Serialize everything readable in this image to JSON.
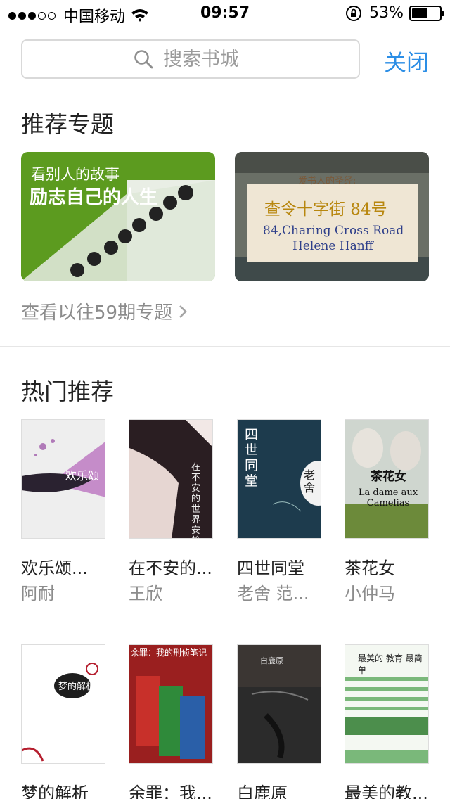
{
  "status_bar": {
    "carrier": "中国移动",
    "time": "09:57",
    "battery_percent": "53%",
    "signal_bars": 3,
    "battery_level": 0.53
  },
  "search": {
    "placeholder": "搜索书城",
    "close_label": "关闭"
  },
  "topics": {
    "title": "推荐专题",
    "cards": [
      {
        "line1": "看别人的故事",
        "line2": "励志自己的人生"
      },
      {
        "heading": "爱书人的圣经:",
        "cn_title": "查令十字街 84号",
        "en_title": "84,Charing Cross Road",
        "en_author": "Helene Hanff"
      }
    ],
    "history_label": "查看以往59期专题"
  },
  "hot": {
    "title": "热门推荐",
    "books": [
      {
        "title": "欢乐颂...",
        "author": "阿耐",
        "cover_text": "欢乐颂"
      },
      {
        "title": "在不安的...",
        "author": "王欣",
        "cover_text": "在不安的世界安静的活"
      },
      {
        "title": "四世同堂",
        "author": "老舍 范...",
        "cover_text": "四世同堂",
        "cover_author": "老舍"
      },
      {
        "title": "茶花女",
        "author": "小仲马",
        "cover_text": "茶花女",
        "cover_sub": "La dame aux Camelias"
      },
      {
        "title": "梦的解析",
        "author": "",
        "cover_text": "梦的解析"
      },
      {
        "title": "余罪：我...",
        "author": "",
        "cover_text": "余罪：我的刑侦笔记"
      },
      {
        "title": "白鹿原",
        "author": "",
        "cover_text": "白鹿原"
      },
      {
        "title": "最美的教...",
        "author": "",
        "cover_text": "最美的 教育 最简单"
      }
    ]
  },
  "colors": {
    "accent": "#2b8ee6",
    "muted_text": "#8c8c8c"
  }
}
